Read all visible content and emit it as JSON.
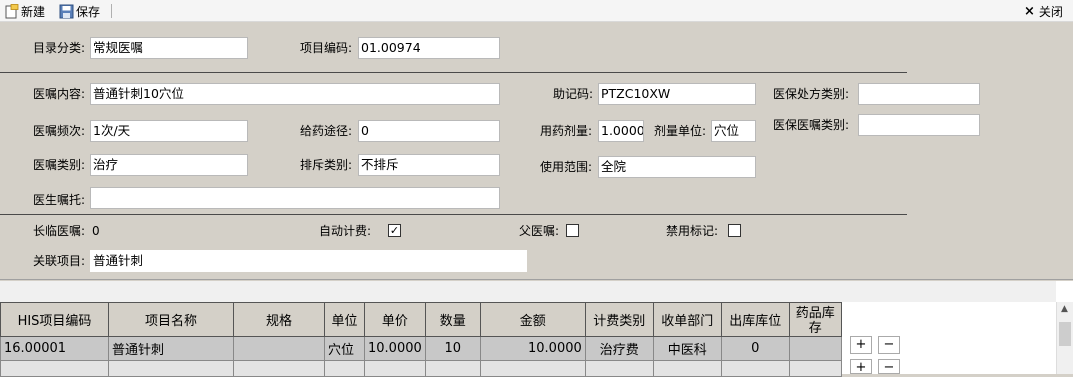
{
  "toolbar": {
    "new_label": "新建",
    "save_label": "保存",
    "close_label": "关闭",
    "close_glyph": "×"
  },
  "form": {
    "catalog_label": "目录分类:",
    "catalog_value": "常规医嘱",
    "item_code_label": "项目编码:",
    "item_code_value": "01.00974",
    "content_label": "医嘱内容:",
    "content_value": "普通针刺10穴位",
    "mnemonic_label": "助记码:",
    "mnemonic_value": "PTZC10XW",
    "insurance_rx_label": "医保处方类别:",
    "insurance_rx_value": "",
    "frequency_label": "医嘱频次:",
    "frequency_value": "1次/天",
    "route_label": "给药途径:",
    "route_value": "0",
    "dose_label": "用药剂量:",
    "dose_value": "1.0000",
    "dose_unit_label": "剂量单位:",
    "dose_unit_value": "穴位",
    "insurance_order_label": "医保医嘱类别:",
    "insurance_order_value": "",
    "order_type_label": "医嘱类别:",
    "order_type_value": "治疗",
    "exclusion_label": "排斥类别:",
    "exclusion_value": "不排斥",
    "scope_label": "使用范围:",
    "scope_value": "全院",
    "doctor_note_label": "医生嘱托:",
    "doctor_note_value": "",
    "long_temp_label": "长临医嘱:",
    "long_temp_value": "0",
    "auto_billing_label": "自动计费:",
    "auto_billing_checked": "✓",
    "parent_order_label": "父医嘱:",
    "disabled_flag_label": "禁用标记:",
    "linked_item_label": "关联项目:",
    "linked_item_value": "普通针刺"
  },
  "grid": {
    "headers": [
      "HIS项目编码",
      "项目名称",
      "规格",
      "单位",
      "单价",
      "数量",
      "金额",
      "计费类别",
      "收单部门",
      "出库库位",
      "药品库存"
    ],
    "rows": [
      [
        "16.00001",
        "普通针刺",
        "",
        "穴位",
        "10.0000",
        "10",
        "10.0000",
        "治疗费",
        "中医科",
        "0",
        ""
      ]
    ],
    "plus_label": "+",
    "minus_label": "−"
  }
}
